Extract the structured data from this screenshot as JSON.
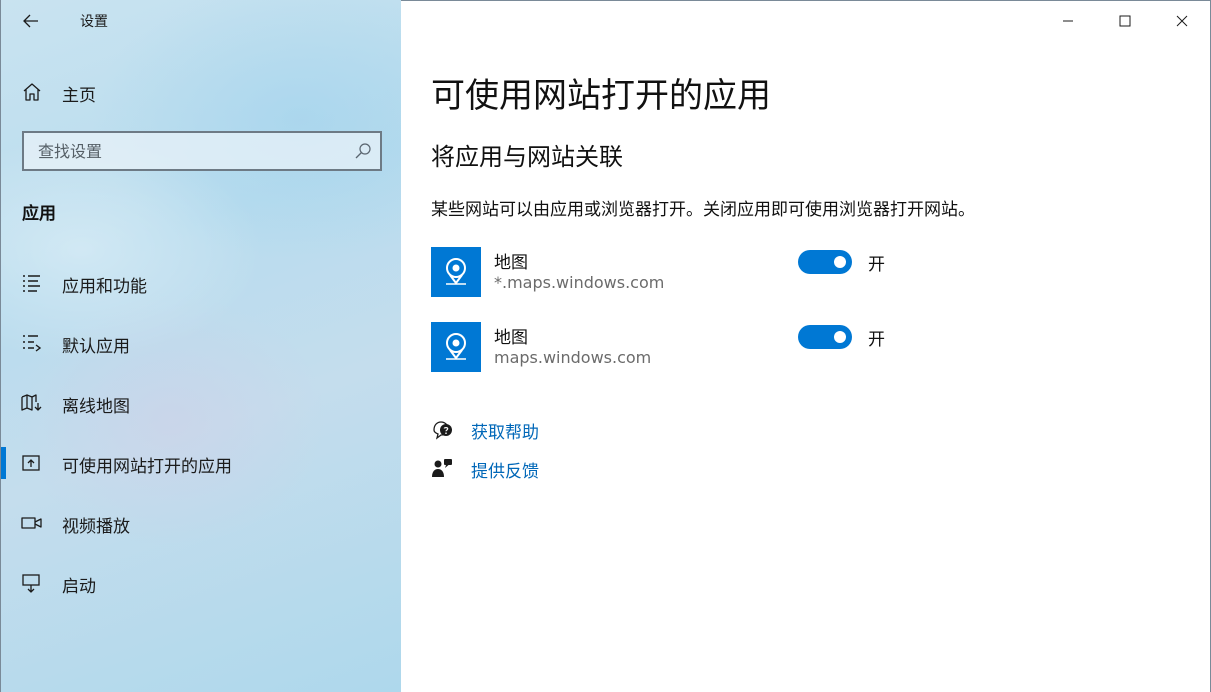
{
  "window": {
    "title": "设置",
    "minimize_icon": "minimize-icon",
    "maximize_icon": "maximize-icon",
    "close_icon": "close-icon"
  },
  "sidebar": {
    "home": {
      "label": "主页",
      "icon": "home-icon"
    },
    "search": {
      "placeholder": "查找设置",
      "value": "",
      "icon": "search-icon"
    },
    "section_title": "应用",
    "items": [
      {
        "label": "应用和功能",
        "icon": "apps-features-icon",
        "active": false
      },
      {
        "label": "默认应用",
        "icon": "default-apps-icon",
        "active": false
      },
      {
        "label": "离线地图",
        "icon": "offline-maps-icon",
        "active": false
      },
      {
        "label": "可使用网站打开的应用",
        "icon": "apps-for-websites-icon",
        "active": true
      },
      {
        "label": "视频播放",
        "icon": "video-playback-icon",
        "active": false
      },
      {
        "label": "启动",
        "icon": "startup-icon",
        "active": false
      }
    ]
  },
  "main": {
    "page_title": "可使用网站打开的应用",
    "subtitle": "将应用与网站关联",
    "description": "某些网站可以由应用或浏览器打开。关闭应用即可使用浏览器打开网站。",
    "apps": [
      {
        "name": "地图",
        "url": "*.maps.windows.com",
        "toggle_on": true,
        "toggle_label": "开",
        "icon": "maps-app-icon"
      },
      {
        "name": "地图",
        "url": "maps.windows.com",
        "toggle_on": true,
        "toggle_label": "开",
        "icon": "maps-app-icon"
      }
    ],
    "links": [
      {
        "label": "获取帮助",
        "icon": "get-help-icon"
      },
      {
        "label": "提供反馈",
        "icon": "feedback-icon"
      }
    ]
  },
  "colors": {
    "accent": "#0078d4",
    "link": "#0067b8",
    "sidebar_bg": "#b8dcee"
  }
}
